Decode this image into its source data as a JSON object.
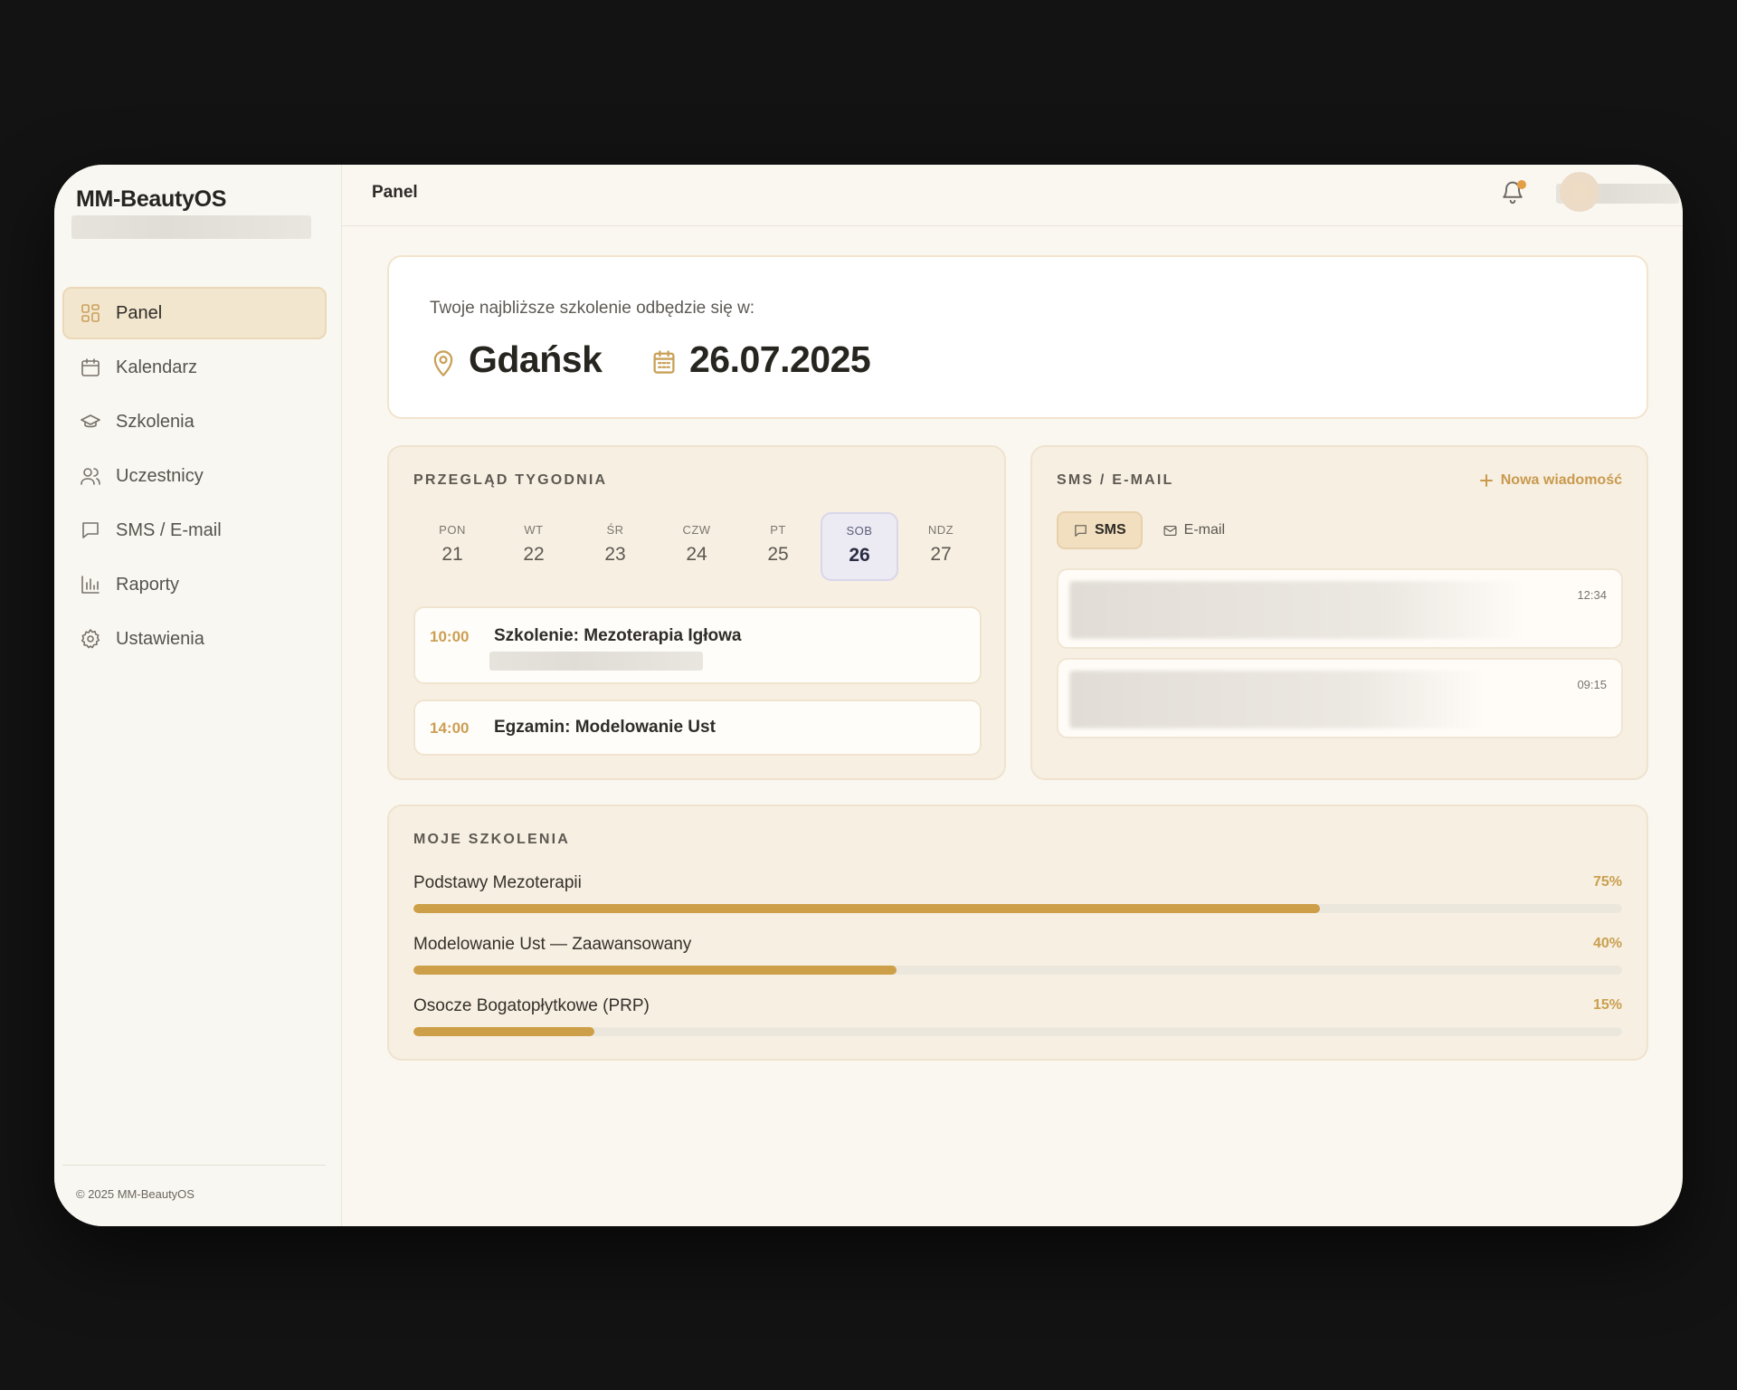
{
  "app": {
    "name": "MM-BeautyOS",
    "footer": "© 2025 MM-BeautyOS"
  },
  "sidebar": {
    "items": [
      {
        "label": "Panel",
        "icon": "grid-icon",
        "active": true
      },
      {
        "label": "Kalendarz",
        "icon": "calendar-icon"
      },
      {
        "label": "Szkolenia",
        "icon": "graduation-cap-icon"
      },
      {
        "label": "Uczestnicy",
        "icon": "users-icon"
      },
      {
        "label": "SMS / E-mail",
        "icon": "message-icon"
      },
      {
        "label": "Raporty",
        "icon": "bar-chart-icon"
      },
      {
        "label": "Ustawienia",
        "icon": "gear-icon"
      }
    ]
  },
  "header": {
    "title": "Panel",
    "has_notification": true
  },
  "next_training": {
    "caption": "Twoje najbliższe szkolenie odbędzie się w:",
    "city": "Gdańsk",
    "date": "26.07.2025"
  },
  "week": {
    "title": "PRZEGLĄD TYGODNIA",
    "days": [
      {
        "name": "PON",
        "num": "21"
      },
      {
        "name": "WT",
        "num": "22"
      },
      {
        "name": "ŚR",
        "num": "23"
      },
      {
        "name": "CZW",
        "num": "24"
      },
      {
        "name": "PT",
        "num": "25"
      },
      {
        "name": "SOB",
        "num": "26",
        "active": true
      },
      {
        "name": "NDZ",
        "num": "27"
      }
    ],
    "events": [
      {
        "time": "10:00",
        "title": "Szkolenie: Mezoterapia Igłowa"
      },
      {
        "time": "14:00",
        "title": "Egzamin: Modelowanie Ust"
      }
    ]
  },
  "messages": {
    "title": "SMS / E-MAIL",
    "new_label": "Nowa wiadomość",
    "tabs": [
      {
        "label": "SMS",
        "active": true
      },
      {
        "label": "E-mail"
      }
    ],
    "items": [
      {
        "time": "12:34"
      },
      {
        "time": "09:15"
      }
    ]
  },
  "courses": {
    "title": "MOJE SZKOLENIA",
    "items": [
      {
        "name": "Podstawy Mezoterapii",
        "progress_label": "75%",
        "progress": 0.75
      },
      {
        "name": "Modelowanie Ust — Zaawansowany",
        "progress_label": "40%",
        "progress": 0.4
      },
      {
        "name": "Osocze Bogatopłytkowe (PRP)",
        "progress_label": "15%",
        "progress": 0.15
      }
    ]
  },
  "colors": {
    "accent": "#cc9f48",
    "active_day": "#ecebf3",
    "panel_bg": "#f7efe2"
  }
}
